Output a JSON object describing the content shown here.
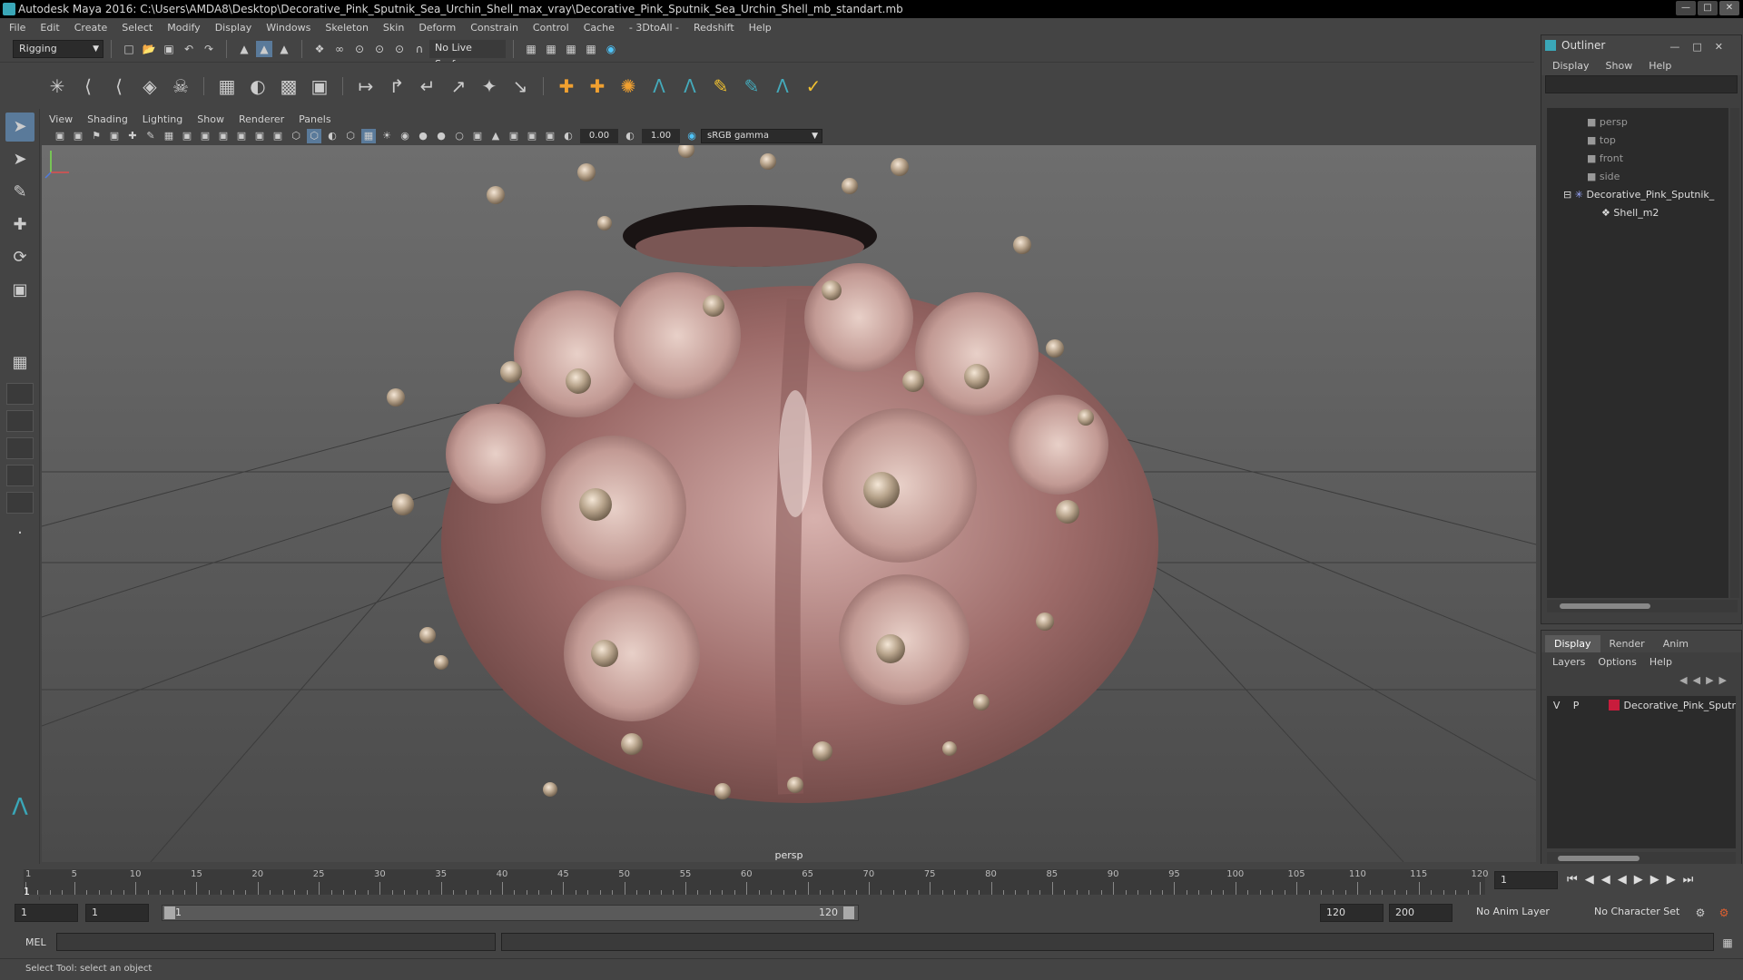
{
  "window": {
    "title": "Autodesk Maya 2016: C:\\Users\\AMDA8\\Desktop\\Decorative_Pink_Sputnik_Sea_Urchin_Shell_max_vray\\Decorative_Pink_Sputnik_Sea_Urchin_Shell_mb_standart.mb"
  },
  "menu": [
    "File",
    "Edit",
    "Create",
    "Select",
    "Modify",
    "Display",
    "Windows",
    "Skeleton",
    "Skin",
    "Deform",
    "Constrain",
    "Control",
    "Cache",
    "- 3DtoAll -",
    "Redshift",
    "Help"
  ],
  "status": {
    "mode": "Rigging",
    "live_surface": "No Live Surface"
  },
  "panel": {
    "menu": [
      "View",
      "Shading",
      "Lighting",
      "Show",
      "Renderer",
      "Panels"
    ],
    "exposure": "0.00",
    "gamma": "1.00",
    "color_space": "sRGB gamma",
    "camera": "persp"
  },
  "outliner": {
    "title": "Outliner",
    "menu": [
      "Display",
      "Show",
      "Help"
    ],
    "items": [
      "persp",
      "top",
      "front",
      "side",
      "Decorative_Pink_Sputnik_",
      "Shell_m2"
    ]
  },
  "layers": {
    "tabs": [
      "Display",
      "Render",
      "Anim"
    ],
    "menu": [
      "Layers",
      "Options",
      "Help"
    ],
    "row": {
      "v": "V",
      "p": "P",
      "name": "Decorative_Pink_Sputr",
      "color": "#c81c3c"
    }
  },
  "timeline": {
    "ticks": [
      "1",
      "5",
      "10",
      "15",
      "20",
      "25",
      "30",
      "35",
      "40",
      "45",
      "50",
      "55",
      "60",
      "65",
      "70",
      "75",
      "80",
      "85",
      "90",
      "95",
      "100",
      "105",
      "110",
      "115",
      "120"
    ],
    "current": "1",
    "current_field": "1"
  },
  "range": {
    "start": "1",
    "start2": "1",
    "bar_start": "1",
    "bar_end": "120",
    "end": "120",
    "end2": "200",
    "anim_layer": "No Anim Layer",
    "char_set": "No Character Set"
  },
  "cmd": {
    "label": "MEL"
  },
  "help": "Select Tool: select an object"
}
